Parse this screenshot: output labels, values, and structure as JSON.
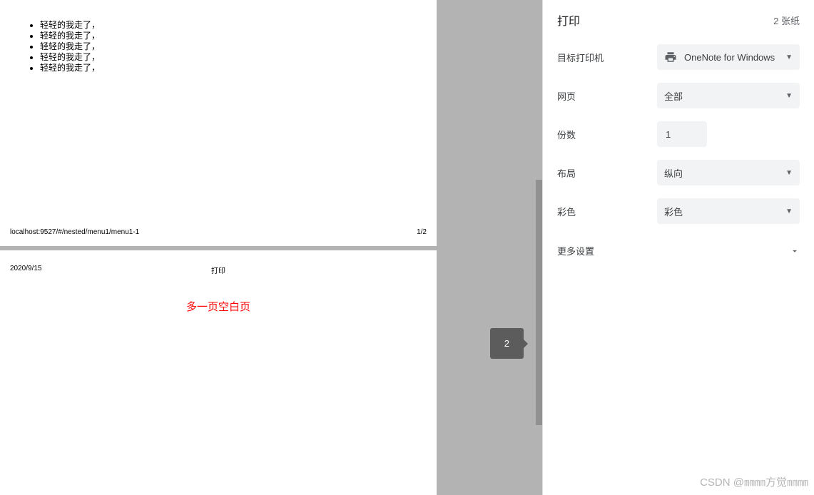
{
  "preview": {
    "page1": {
      "items": [
        "轻轻的我走了，",
        "轻轻的我走了，",
        "轻轻的我走了，",
        "轻轻的我走了，",
        "轻轻的我走了，"
      ],
      "footer_left": "localhost:9527/#/nested/menu1/menu1-1",
      "footer_right": "1/2"
    },
    "page2": {
      "date": "2020/9/15",
      "title": "打印",
      "annotation": "多一页空白页"
    },
    "indicator": "2"
  },
  "panel": {
    "title": "打印",
    "sheet_count": "2 张纸",
    "rows": {
      "printer_label": "目标打印机",
      "printer_value": "OneNote for Windows",
      "pages_label": "网页",
      "pages_value": "全部",
      "copies_label": "份数",
      "copies_value": "1",
      "layout_label": "布局",
      "layout_value": "纵向",
      "color_label": "彩色",
      "color_value": "彩色"
    },
    "more": "更多设置"
  },
  "watermark": "CSDN @㎜㎜方觉㎜㎜"
}
